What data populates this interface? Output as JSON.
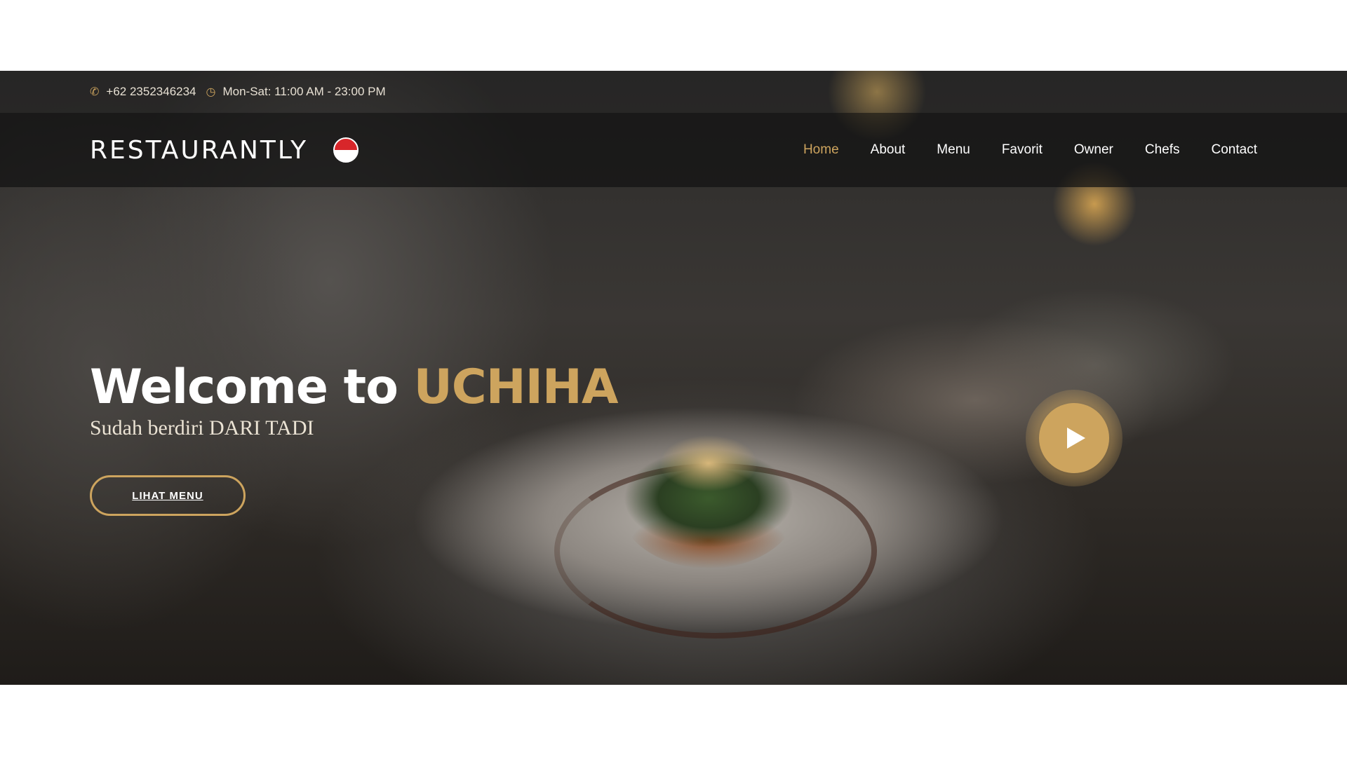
{
  "topbar": {
    "phone_icon": "phone-icon",
    "phone": "+62 2352346234",
    "clock_icon": "clock-icon",
    "hours": "Mon-Sat: 11:00 AM - 23:00 PM"
  },
  "header": {
    "logo_text": "RESTAURANTLY",
    "logo_icon": "uchiha-fan-icon",
    "nav": [
      {
        "label": "Home",
        "active": true
      },
      {
        "label": "About"
      },
      {
        "label": "Menu"
      },
      {
        "label": "Favorit"
      },
      {
        "label": "Owner"
      },
      {
        "label": "Chefs"
      },
      {
        "label": "Contact"
      }
    ]
  },
  "hero": {
    "welcome_prefix": "Welcome to ",
    "brand": "UCHIHA",
    "subtitle": "Sudah berdiri DARI TADI",
    "cta_label": "LIHAT MENU",
    "play_icon": "play-icon"
  },
  "colors": {
    "accent": "#cda45e",
    "text": "#ffffff",
    "logo_mark_red": "#d8262a"
  }
}
